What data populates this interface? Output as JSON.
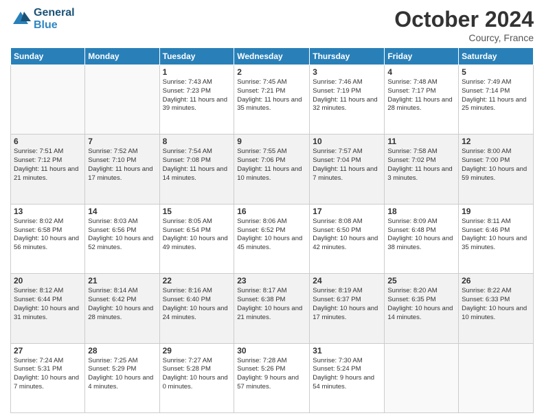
{
  "header": {
    "logo_line1": "General",
    "logo_line2": "Blue",
    "month": "October 2024",
    "location": "Courcy, France"
  },
  "weekdays": [
    "Sunday",
    "Monday",
    "Tuesday",
    "Wednesday",
    "Thursday",
    "Friday",
    "Saturday"
  ],
  "weeks": [
    [
      {
        "day": "",
        "info": ""
      },
      {
        "day": "",
        "info": ""
      },
      {
        "day": "1",
        "info": "Sunrise: 7:43 AM\nSunset: 7:23 PM\nDaylight: 11 hours and 39 minutes."
      },
      {
        "day": "2",
        "info": "Sunrise: 7:45 AM\nSunset: 7:21 PM\nDaylight: 11 hours and 35 minutes."
      },
      {
        "day": "3",
        "info": "Sunrise: 7:46 AM\nSunset: 7:19 PM\nDaylight: 11 hours and 32 minutes."
      },
      {
        "day": "4",
        "info": "Sunrise: 7:48 AM\nSunset: 7:17 PM\nDaylight: 11 hours and 28 minutes."
      },
      {
        "day": "5",
        "info": "Sunrise: 7:49 AM\nSunset: 7:14 PM\nDaylight: 11 hours and 25 minutes."
      }
    ],
    [
      {
        "day": "6",
        "info": "Sunrise: 7:51 AM\nSunset: 7:12 PM\nDaylight: 11 hours and 21 minutes."
      },
      {
        "day": "7",
        "info": "Sunrise: 7:52 AM\nSunset: 7:10 PM\nDaylight: 11 hours and 17 minutes."
      },
      {
        "day": "8",
        "info": "Sunrise: 7:54 AM\nSunset: 7:08 PM\nDaylight: 11 hours and 14 minutes."
      },
      {
        "day": "9",
        "info": "Sunrise: 7:55 AM\nSunset: 7:06 PM\nDaylight: 11 hours and 10 minutes."
      },
      {
        "day": "10",
        "info": "Sunrise: 7:57 AM\nSunset: 7:04 PM\nDaylight: 11 hours and 7 minutes."
      },
      {
        "day": "11",
        "info": "Sunrise: 7:58 AM\nSunset: 7:02 PM\nDaylight: 11 hours and 3 minutes."
      },
      {
        "day": "12",
        "info": "Sunrise: 8:00 AM\nSunset: 7:00 PM\nDaylight: 10 hours and 59 minutes."
      }
    ],
    [
      {
        "day": "13",
        "info": "Sunrise: 8:02 AM\nSunset: 6:58 PM\nDaylight: 10 hours and 56 minutes."
      },
      {
        "day": "14",
        "info": "Sunrise: 8:03 AM\nSunset: 6:56 PM\nDaylight: 10 hours and 52 minutes."
      },
      {
        "day": "15",
        "info": "Sunrise: 8:05 AM\nSunset: 6:54 PM\nDaylight: 10 hours and 49 minutes."
      },
      {
        "day": "16",
        "info": "Sunrise: 8:06 AM\nSunset: 6:52 PM\nDaylight: 10 hours and 45 minutes."
      },
      {
        "day": "17",
        "info": "Sunrise: 8:08 AM\nSunset: 6:50 PM\nDaylight: 10 hours and 42 minutes."
      },
      {
        "day": "18",
        "info": "Sunrise: 8:09 AM\nSunset: 6:48 PM\nDaylight: 10 hours and 38 minutes."
      },
      {
        "day": "19",
        "info": "Sunrise: 8:11 AM\nSunset: 6:46 PM\nDaylight: 10 hours and 35 minutes."
      }
    ],
    [
      {
        "day": "20",
        "info": "Sunrise: 8:12 AM\nSunset: 6:44 PM\nDaylight: 10 hours and 31 minutes."
      },
      {
        "day": "21",
        "info": "Sunrise: 8:14 AM\nSunset: 6:42 PM\nDaylight: 10 hours and 28 minutes."
      },
      {
        "day": "22",
        "info": "Sunrise: 8:16 AM\nSunset: 6:40 PM\nDaylight: 10 hours and 24 minutes."
      },
      {
        "day": "23",
        "info": "Sunrise: 8:17 AM\nSunset: 6:38 PM\nDaylight: 10 hours and 21 minutes."
      },
      {
        "day": "24",
        "info": "Sunrise: 8:19 AM\nSunset: 6:37 PM\nDaylight: 10 hours and 17 minutes."
      },
      {
        "day": "25",
        "info": "Sunrise: 8:20 AM\nSunset: 6:35 PM\nDaylight: 10 hours and 14 minutes."
      },
      {
        "day": "26",
        "info": "Sunrise: 8:22 AM\nSunset: 6:33 PM\nDaylight: 10 hours and 10 minutes."
      }
    ],
    [
      {
        "day": "27",
        "info": "Sunrise: 7:24 AM\nSunset: 5:31 PM\nDaylight: 10 hours and 7 minutes."
      },
      {
        "day": "28",
        "info": "Sunrise: 7:25 AM\nSunset: 5:29 PM\nDaylight: 10 hours and 4 minutes."
      },
      {
        "day": "29",
        "info": "Sunrise: 7:27 AM\nSunset: 5:28 PM\nDaylight: 10 hours and 0 minutes."
      },
      {
        "day": "30",
        "info": "Sunrise: 7:28 AM\nSunset: 5:26 PM\nDaylight: 9 hours and 57 minutes."
      },
      {
        "day": "31",
        "info": "Sunrise: 7:30 AM\nSunset: 5:24 PM\nDaylight: 9 hours and 54 minutes."
      },
      {
        "day": "",
        "info": ""
      },
      {
        "day": "",
        "info": ""
      }
    ]
  ]
}
